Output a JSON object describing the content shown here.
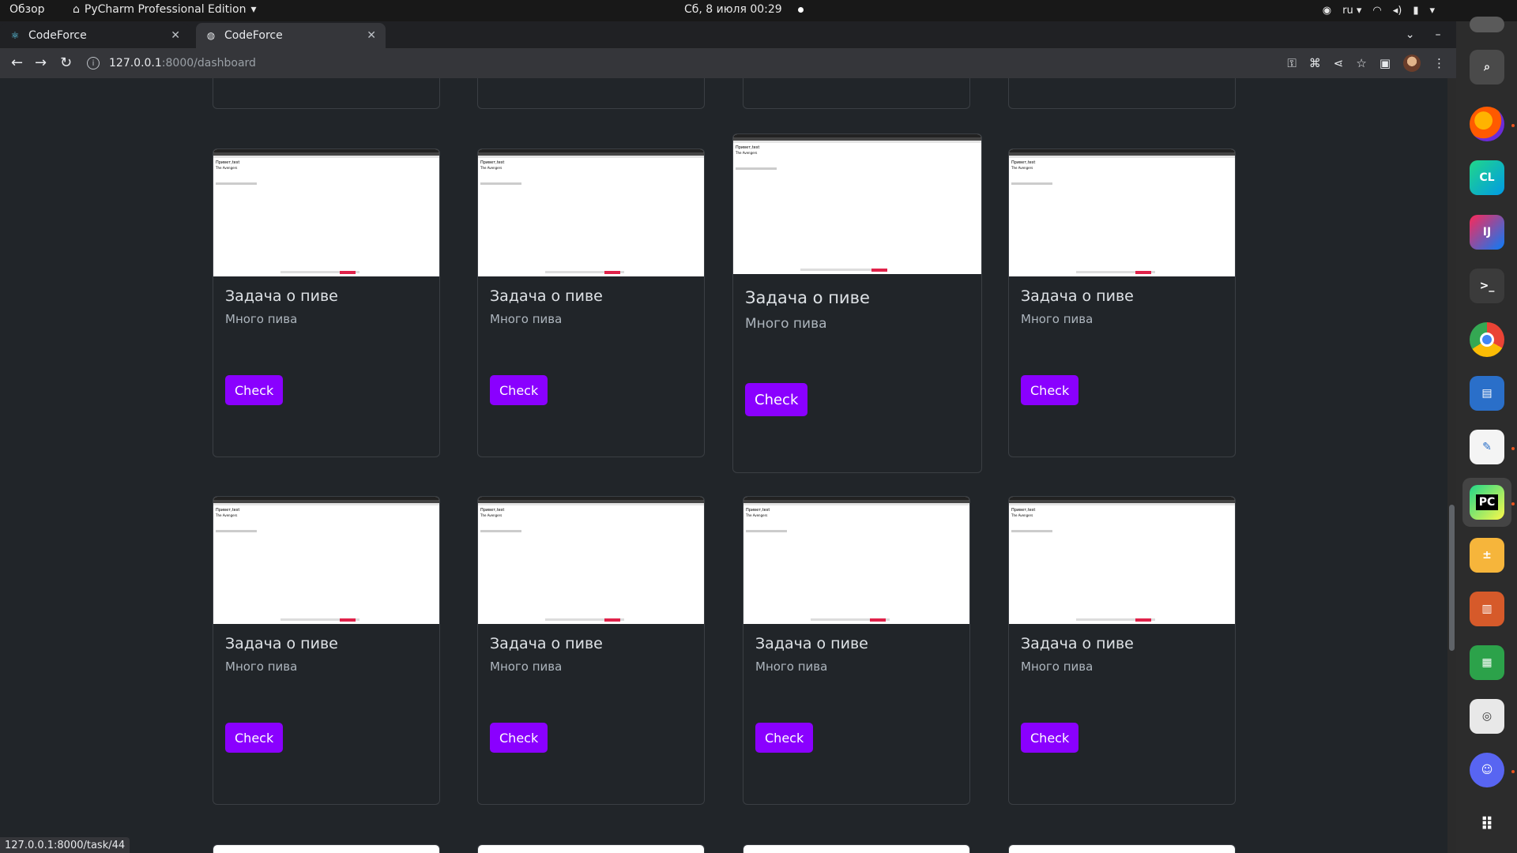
{
  "topbar": {
    "activities": "Обзор",
    "app_menu": "PyCharm Professional Edition",
    "clock": "Сб, 8 июля  00:29",
    "lang": "ru"
  },
  "browser": {
    "tabs": [
      {
        "title": "CodeForce",
        "active": false
      },
      {
        "title": "CodeForce",
        "active": true
      }
    ],
    "url_host": "127.0.0.1",
    "url_path": ":8000/dashboard",
    "status_url": "127.0.0.1:8000/task/44"
  },
  "cards": [
    {
      "title": "Задача о пиве",
      "desc": "Много пива",
      "button": "Check",
      "shot_title": "Привет,test",
      "shot_sub": "The Avengers"
    },
    {
      "title": "Задача о пиве",
      "desc": "Много пива",
      "button": "Check",
      "shot_title": "Привет,test",
      "shot_sub": "The Avengers"
    },
    {
      "title": "Задача о пиве",
      "desc": "Много пива",
      "button": "Check",
      "shot_title": "Привет,test",
      "shot_sub": "The Avengers"
    },
    {
      "title": "Задача о пиве",
      "desc": "Много пива",
      "button": "Check",
      "shot_title": "Привет,test",
      "shot_sub": "The Avengers"
    },
    {
      "title": "Задача о пиве",
      "desc": "Много пива",
      "button": "Check",
      "shot_title": "Привет,test",
      "shot_sub": "The Avengers"
    },
    {
      "title": "Задача о пиве",
      "desc": "Много пива",
      "button": "Check",
      "shot_title": "Привет,test",
      "shot_sub": "The Avengers"
    },
    {
      "title": "Задача о пиве",
      "desc": "Много пива",
      "button": "Check",
      "shot_title": "Привет,test",
      "shot_sub": "The Avengers"
    },
    {
      "title": "Задача о пиве",
      "desc": "Много пива",
      "button": "Check",
      "shot_title": "Привет,test",
      "shot_sub": "The Avengers"
    }
  ],
  "dock_apps": [
    {
      "name": "files-icon"
    },
    {
      "name": "search-icon"
    },
    {
      "name": "firefox-icon"
    },
    {
      "name": "clion-icon",
      "label": "CL"
    },
    {
      "name": "intellij-icon",
      "label": "IJ"
    },
    {
      "name": "terminal-icon",
      "label": ">_"
    },
    {
      "name": "chrome-icon"
    },
    {
      "name": "writer-icon"
    },
    {
      "name": "text-editor-icon"
    },
    {
      "name": "pycharm-icon",
      "label": "PC"
    },
    {
      "name": "calculator-icon"
    },
    {
      "name": "impress-icon"
    },
    {
      "name": "calc-icon"
    },
    {
      "name": "reader-icon"
    },
    {
      "name": "discord-icon"
    },
    {
      "name": "show-apps-icon"
    }
  ],
  "colors": {
    "accent": "#8a00ff",
    "page_bg": "#212529",
    "card_border": "#3b3f44"
  }
}
